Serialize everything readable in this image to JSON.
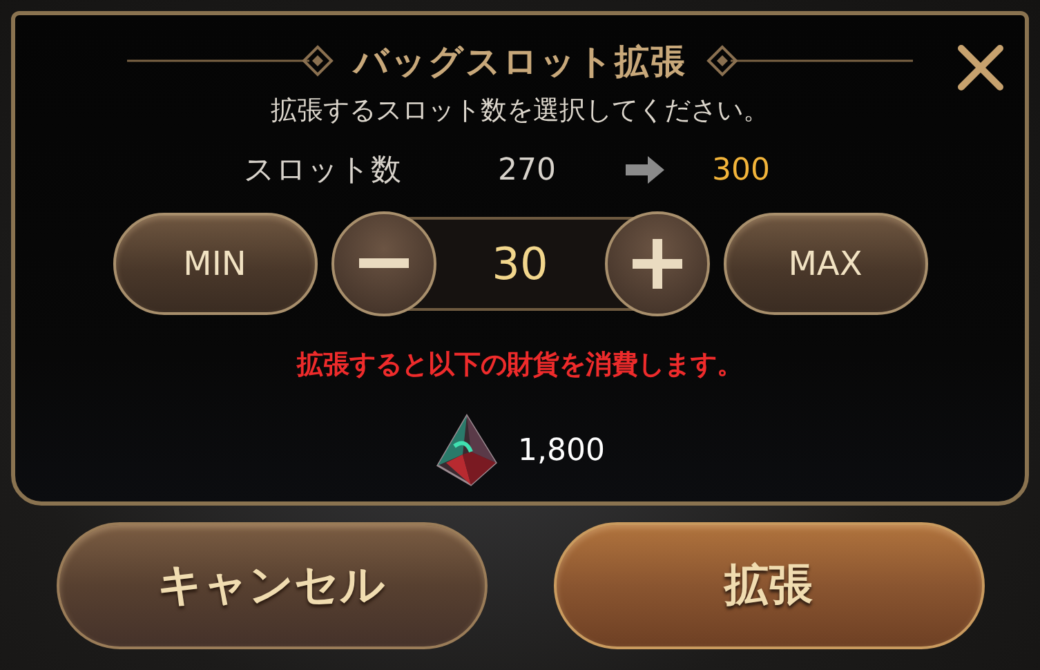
{
  "dialog": {
    "title": "バッグスロット拡張",
    "instruction": "拡張するスロット数を選択してください。",
    "slot_label": "スロット数",
    "slot_current": "270",
    "slot_after": "300",
    "min_button": "MIN",
    "quantity": "30",
    "max_button": "MAX",
    "warning": "拡張すると以下の財貨を消費します。",
    "cost": "1,800"
  },
  "buttons": [
    {
      "label": "キャンセル",
      "kind": "secondary"
    },
    {
      "label": "拡張",
      "kind": "primary"
    }
  ]
}
